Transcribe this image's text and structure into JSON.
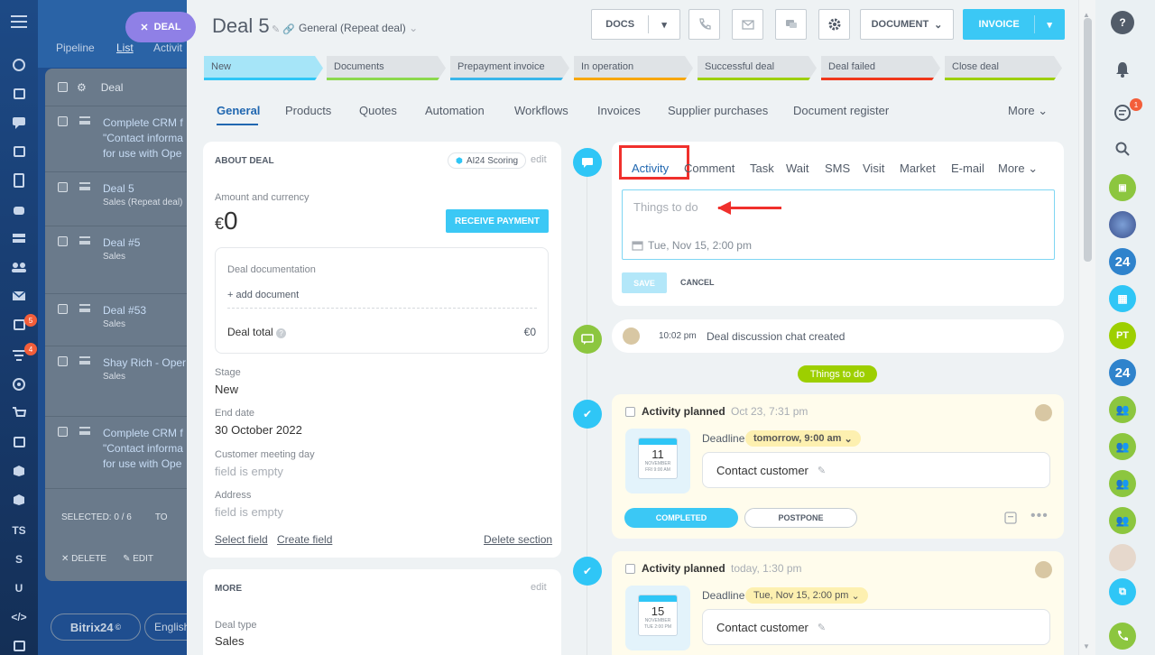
{
  "background": {
    "deal_pill": "DEAL",
    "tabs": [
      "Pipeline",
      "List",
      "Activit"
    ],
    "list_header": "Deal",
    "rows": [
      {
        "title": "Complete CRM f\n\"Contact informa\nfor use with Ope",
        "sub": ""
      },
      {
        "title": "Deal 5",
        "sub": "Sales (Repeat deal)"
      },
      {
        "title": "Deal #5",
        "sub": "Sales"
      },
      {
        "title": "Deal #53",
        "sub": "Sales"
      },
      {
        "title": "Shay Rich - Oper",
        "sub": "Sales"
      },
      {
        "title": "Complete CRM f\n\"Contact informa\nfor use with Ope",
        "sub": ""
      }
    ],
    "selected": "SELECTED: 0 / 6",
    "tot": "TO",
    "delete": "DELETE",
    "edit": "EDIT",
    "bitrix": "Bitrix24",
    "english": "English",
    "left_badges": {
      "tasks": "5",
      "filters": "4"
    },
    "left_texts": [
      "TS",
      "S",
      "U"
    ]
  },
  "deal": {
    "title": "Deal 5",
    "category": "General (Repeat deal)"
  },
  "toolbar": {
    "docs": "DOCS",
    "document": "DOCUMENT",
    "invoice": "INVOICE"
  },
  "stages": [
    {
      "label": "New",
      "color": "#a6e5f8",
      "bar": "#2fc6f6"
    },
    {
      "label": "Documents",
      "color": "#dfe3e6",
      "bar": "#8cd94d"
    },
    {
      "label": "Prepayment invoice",
      "color": "#dfe3e6",
      "bar": "#39b6ea"
    },
    {
      "label": "In operation",
      "color": "#dfe3e6",
      "bar": "#f7a700"
    },
    {
      "label": "Successful deal",
      "color": "#dfe3e6",
      "bar": "#9dcf00"
    },
    {
      "label": "Deal failed",
      "color": "#dfe3e6",
      "bar": "#f0371b"
    },
    {
      "label": "Close deal",
      "color": "#dfe3e6",
      "bar": "#9dcf00"
    }
  ],
  "tabs": [
    "General",
    "Products",
    "Quotes",
    "Automation",
    "Workflows",
    "Invoices",
    "Supplier purchases",
    "Document register"
  ],
  "tabs_more": "More",
  "about": {
    "header": "ABOUT DEAL",
    "scoring": "AI24 Scoring",
    "edit": "edit",
    "amount_label": "Amount and currency",
    "currency": "€",
    "amount": "0",
    "receive": "RECEIVE PAYMENT",
    "doc_label": "Deal documentation",
    "add_doc": "+ add document",
    "total_label": "Deal total",
    "total_value": "€0",
    "stage_label": "Stage",
    "stage_value": "New",
    "end_label": "End date",
    "end_value": "30 October 2022",
    "meet_label": "Customer meeting day",
    "meet_value": "field is empty",
    "addr_label": "Address",
    "addr_value": "field is empty",
    "select_field": "Select field",
    "create_field": "Create field",
    "delete_section": "Delete section"
  },
  "more_section": {
    "header": "MORE",
    "edit": "edit",
    "type_label": "Deal type",
    "type_value": "Sales"
  },
  "activity": {
    "tabs": [
      "Activity",
      "Comment",
      "Task",
      "Wait",
      "SMS",
      "Visit",
      "Market",
      "E-mail"
    ],
    "more": "More",
    "placeholder": "Things to do",
    "date": "Tue, Nov 15, 2:00 pm",
    "save": "SAVE",
    "cancel": "CANCEL"
  },
  "feed": {
    "chat_time": "10:02 pm",
    "chat_text": "Deal discussion chat created",
    "todo_badge": "Things to do",
    "items": [
      {
        "title": "Activity planned",
        "time": "Oct 23, 7:31 pm",
        "day": "11",
        "month": "NOVEMBER",
        "weekday": "FRI 9:00 AM",
        "deadline_label": "Deadline",
        "deadline": "tomorrow, 9:00 am",
        "text": "Contact customer",
        "completed": "COMPLETED",
        "postpone": "POSTPONE"
      },
      {
        "title": "Activity planned",
        "time": "today, 1:30 pm",
        "day": "15",
        "month": "NOVEMBER",
        "weekday": "TUE 2:00 PM",
        "deadline_label": "Deadline",
        "deadline": "Tue, Nov 15, 2:00 pm",
        "text": "Contact customer"
      }
    ]
  },
  "rightbar": {
    "chat_badge": "1",
    "avatars": [
      "24",
      "PT",
      "24"
    ]
  },
  "colors": {
    "accent": "#3bc8f5",
    "highlight_box": "#f0302c",
    "arrow": "#f0302c",
    "feed_green": "#8cc63f",
    "feed_blue": "#2fc6f6"
  }
}
